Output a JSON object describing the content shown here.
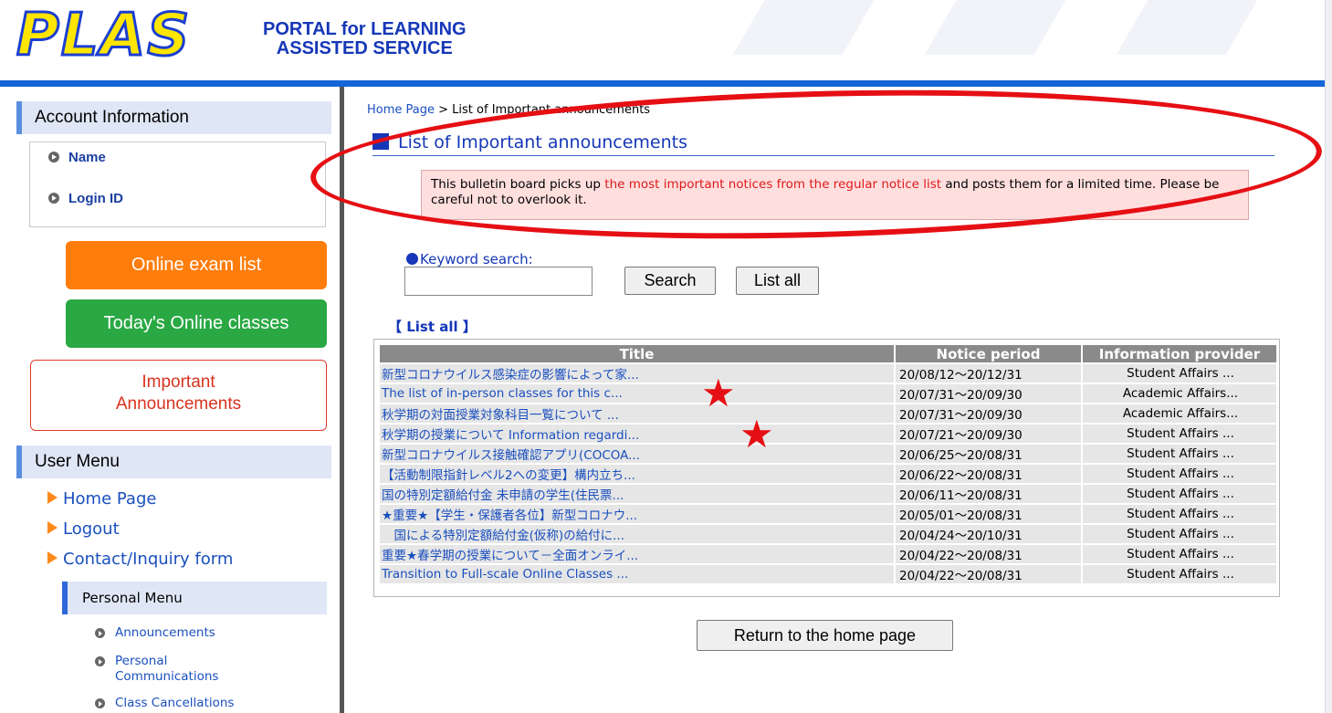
{
  "header": {
    "logo_text": "PLAS",
    "subtitle_line1": "PORTAL for LEARNING",
    "subtitle_line2": "ASSISTED SERVICE"
  },
  "sidebar": {
    "account_heading": "Account Information",
    "account_items": [
      "Name",
      "Login ID"
    ],
    "online_exam_button": "Online exam list",
    "online_classes_button": "Today's Online classes",
    "important_button": "Important\nAnnouncements",
    "important_line1": "Important",
    "important_line2": "Announcements",
    "user_menu_heading": "User Menu",
    "user_menu_items": [
      "Home Page",
      "Logout",
      "Contact/Inquiry form"
    ],
    "personal_menu_heading": "Personal Menu",
    "personal_menu_items": [
      "Announcements",
      "Personal Communications",
      "Class Cancellations"
    ],
    "personal_line1": "Personal",
    "personal_line2": "Communications"
  },
  "main": {
    "breadcrumb_home": "Home Page",
    "breadcrumb_sep": " > ",
    "breadcrumb_current": "List of Important announcements",
    "page_title": "List of Important announcements",
    "notice_part1": "This bulletin board picks up ",
    "notice_highlight": "the most important notices from the regular notice list",
    "notice_part2": " and posts them for a limited time. Please be careful not to overlook it.",
    "keyword_label": "Keyword search:",
    "search_button": "Search",
    "list_all_button": "List all",
    "list_all_heading": "【 List all 】",
    "return_button": "Return to the home page",
    "table": {
      "headers": [
        "Title",
        "Notice period",
        "Information provider"
      ],
      "rows": [
        {
          "title": "新型コロナウイルス感染症の影響によって家...",
          "period": "20/08/12～20/12/31",
          "provider": "Student Affairs ..."
        },
        {
          "title": "The list of in-person classes for this c...",
          "period": "20/07/31～20/09/30",
          "provider": "Academic Affairs..."
        },
        {
          "title": "秋学期の対面授業対象科目一覧について ...",
          "period": "20/07/31～20/09/30",
          "provider": "Academic Affairs..."
        },
        {
          "title": "秋学期の授業について Information regardi...",
          "period": "20/07/21～20/09/30",
          "provider": "Student Affairs ..."
        },
        {
          "title": "新型コロナウイルス接触確認アプリ(COCOA...",
          "period": "20/06/25～20/08/31",
          "provider": "Student Affairs ..."
        },
        {
          "title": "【活動制限指針レベル2への変更】構内立ち...",
          "period": "20/06/22～20/08/31",
          "provider": "Student Affairs ..."
        },
        {
          "title": "国の特別定額給付金 未申請の学生(住民票...",
          "period": "20/06/11～20/08/31",
          "provider": "Student Affairs ..."
        },
        {
          "title": "★重要★【学生・保護者各位】新型コロナウ...",
          "period": "20/05/01～20/08/31",
          "provider": "Student Affairs ..."
        },
        {
          "title": "　国による特別定額給付金(仮称)の給付に...",
          "period": "20/04/24～20/10/31",
          "provider": "Student Affairs ..."
        },
        {
          "title": "重要★春学期の授業について－全面オンライ...",
          "period": "20/04/22～20/08/31",
          "provider": "Student Affairs ..."
        },
        {
          "title": "Transition to Full-scale Online Classes ...",
          "period": "20/04/22～20/08/31",
          "provider": "Student Affairs ..."
        }
      ]
    }
  },
  "annotations": {
    "star_glyph": "★",
    "highlight_color": "#e50f14"
  }
}
